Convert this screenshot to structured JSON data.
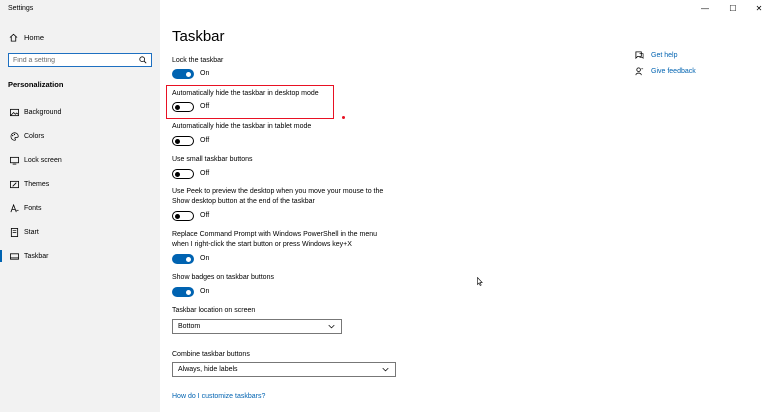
{
  "window": {
    "title": "Settings",
    "controls": {
      "minimize": "—",
      "maximize": "☐",
      "close": "✕"
    }
  },
  "sidebar": {
    "home_label": "Home",
    "search_placeholder": "Find a setting",
    "section_title": "Personalization",
    "items": [
      {
        "label": "Background",
        "icon": "picture-icon"
      },
      {
        "label": "Colors",
        "icon": "palette-icon"
      },
      {
        "label": "Lock screen",
        "icon": "lock-screen-icon"
      },
      {
        "label": "Themes",
        "icon": "brush-icon"
      },
      {
        "label": "Fonts",
        "icon": "font-icon"
      },
      {
        "label": "Start",
        "icon": "start-icon"
      },
      {
        "label": "Taskbar",
        "icon": "taskbar-icon",
        "active": true
      }
    ]
  },
  "main": {
    "title": "Taskbar",
    "settings": [
      {
        "label": "Lock the taskbar",
        "state": "On"
      },
      {
        "label": "Automatically hide the taskbar in desktop mode",
        "state": "Off"
      },
      {
        "label": "Automatically hide the taskbar in tablet mode",
        "state": "Off"
      },
      {
        "label": "Use small taskbar buttons",
        "state": "Off"
      },
      {
        "label_line1": "Use Peek to preview the desktop when you move your mouse to the",
        "label_line2": "Show desktop button at the end of the taskbar",
        "state": "Off"
      },
      {
        "label_line1": "Replace Command Prompt with Windows PowerShell in the menu",
        "label_line2": "when I right-click the start button or press Windows key+X",
        "state": "On"
      },
      {
        "label": "Show badges on taskbar buttons",
        "state": "On"
      }
    ],
    "location": {
      "label": "Taskbar location on screen",
      "value": "Bottom"
    },
    "combine": {
      "label": "Combine taskbar buttons",
      "value": "Always, hide labels"
    },
    "customize_link": "How do I customize taskbars?"
  },
  "help": {
    "get_help": "Get help",
    "give_feedback": "Give feedback"
  },
  "colors": {
    "accent": "#0063b1",
    "highlight": "#e81123"
  }
}
